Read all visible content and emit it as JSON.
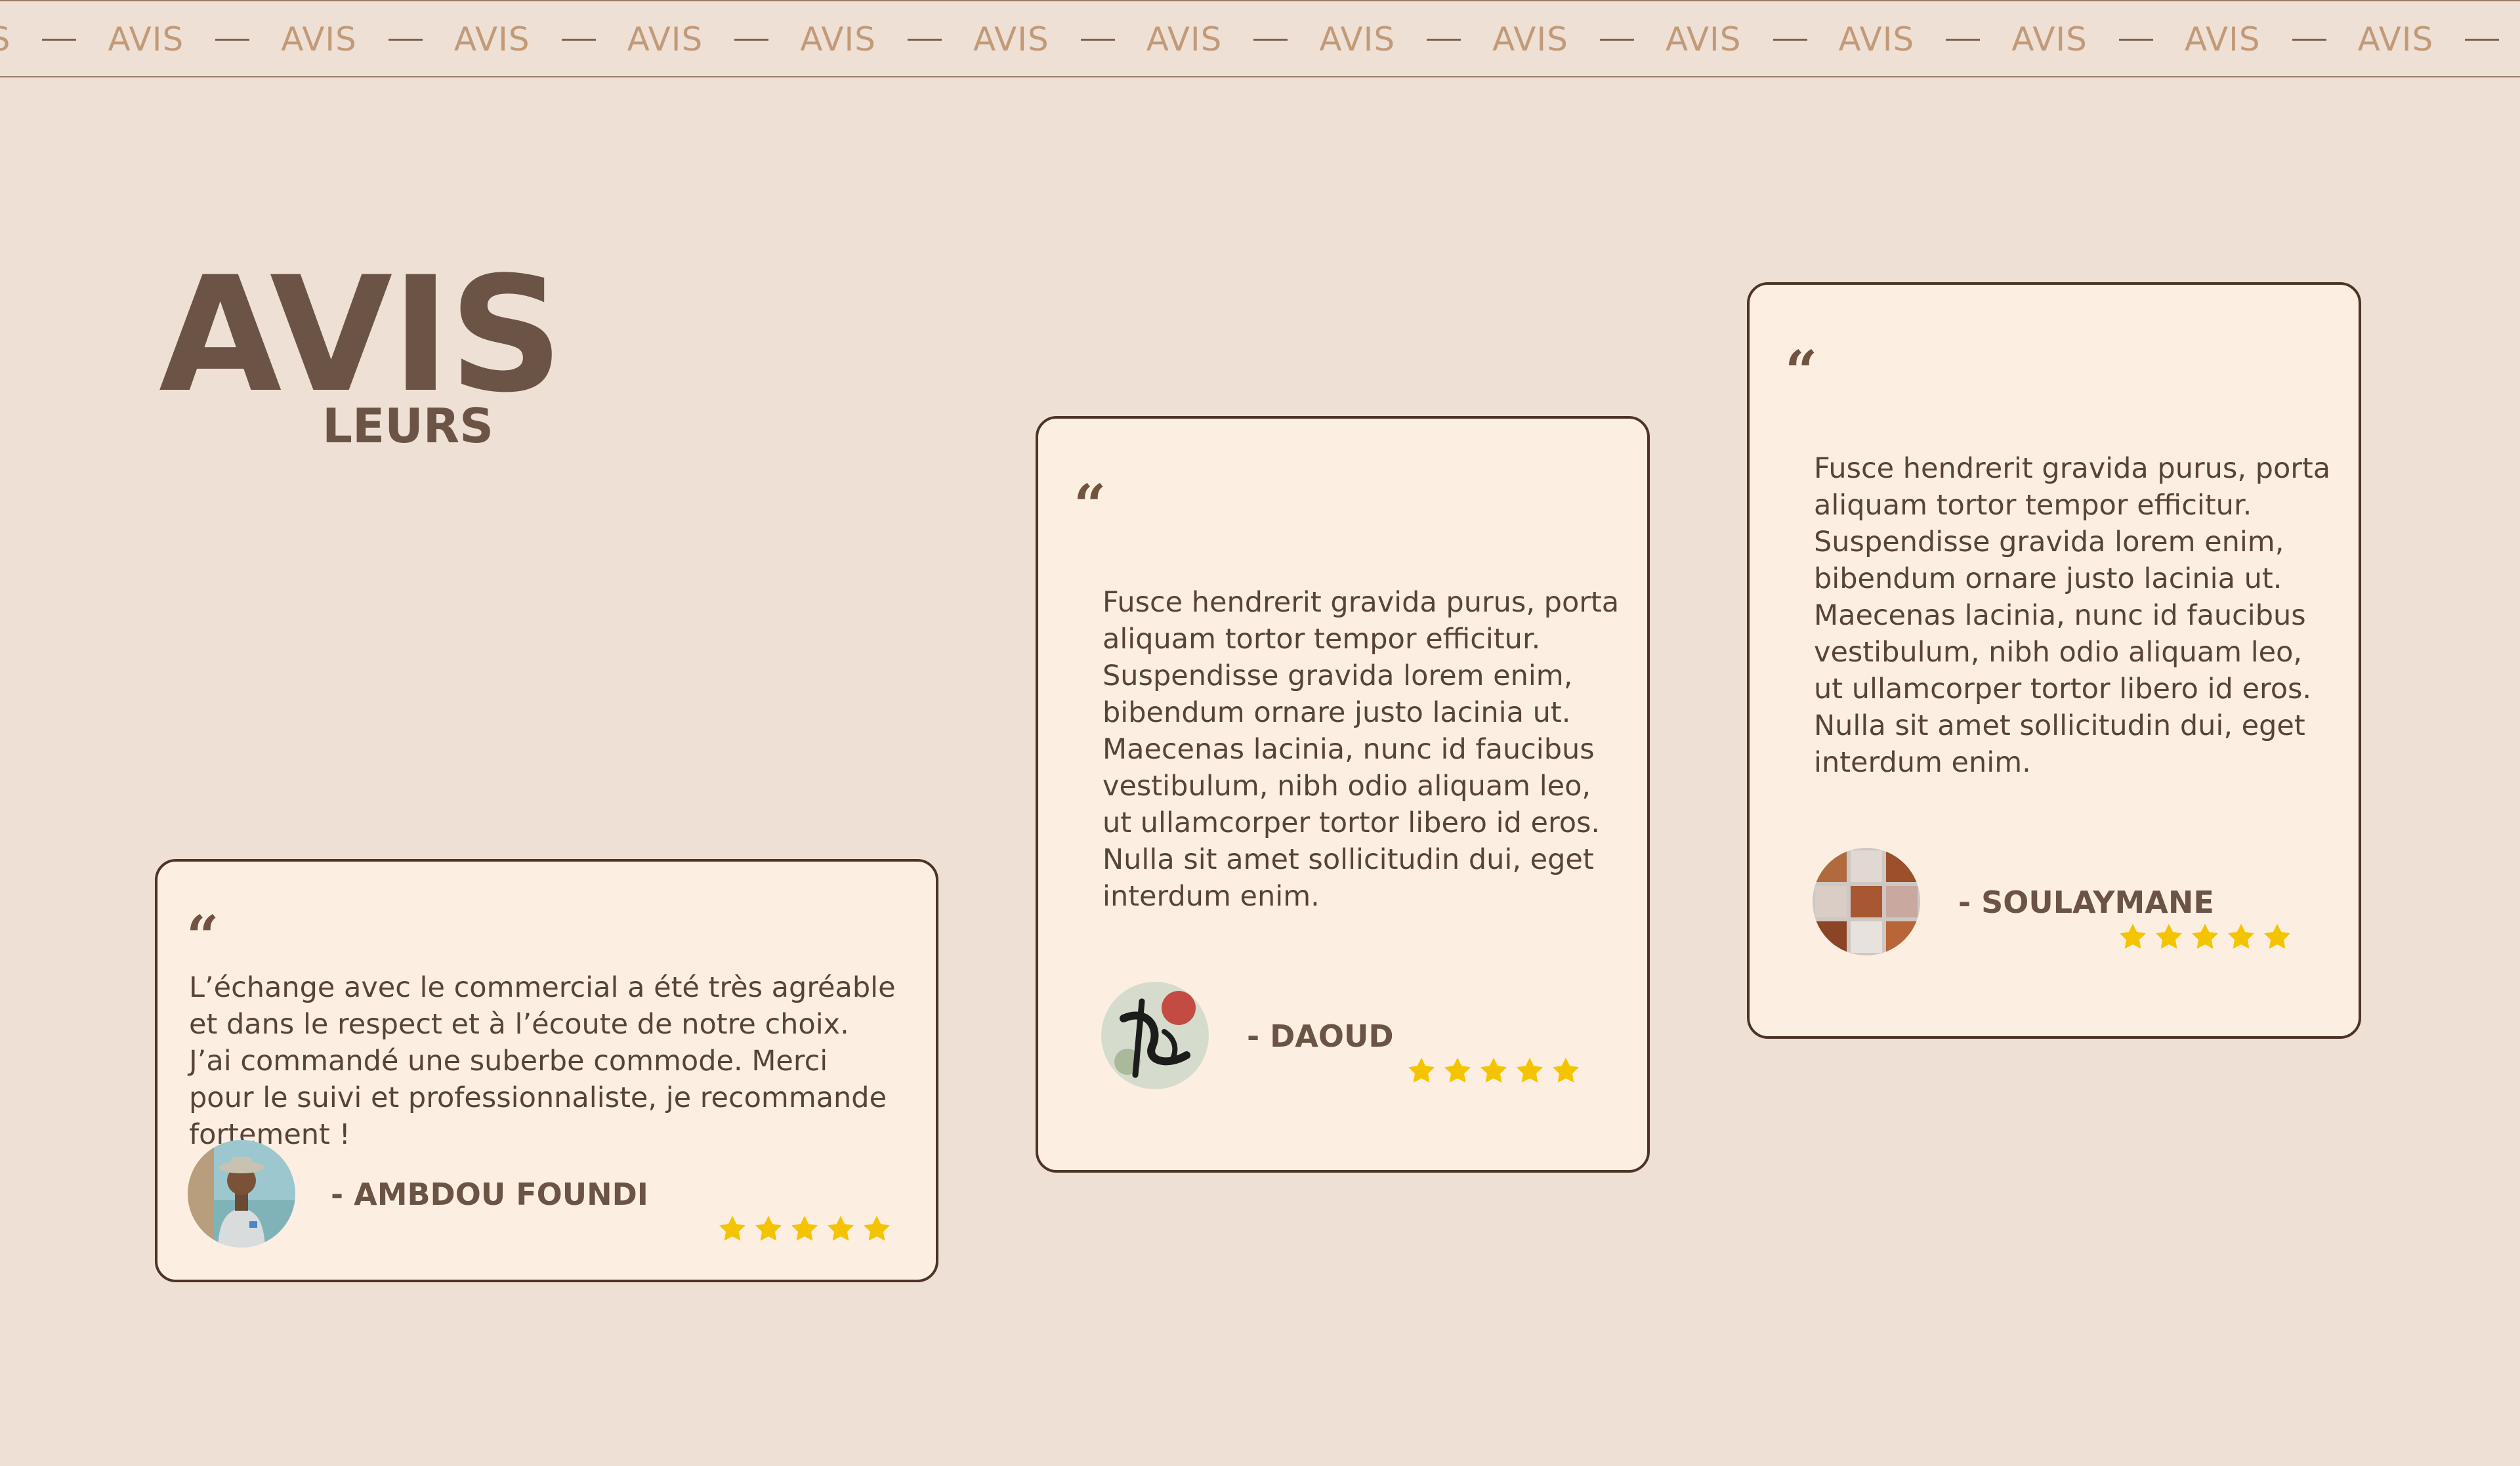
{
  "ticker": {
    "word": "AVIS",
    "first_partial": "IS"
  },
  "heading": {
    "main": "AVIS",
    "sub": "LEURS"
  },
  "reviews": [
    {
      "quote": "“",
      "text": "L’échange avec le commercial a été très agréable et dans le respect et à l’écoute de notre choix. J’ai commandé une suberbe commode. Merci pour le suivi et professionnaliste, je recommande fortement !",
      "author": "- AMBDOU FOUNDI",
      "rating": 5
    },
    {
      "quote": "“",
      "text": "Fusce hendrerit gravida purus, porta aliquam tortor tempor efficitur. Suspendisse gravida lorem enim, bibendum ornare justo lacinia ut. Maecenas lacinia, nunc id faucibus vestibulum, nibh odio aliquam leo, ut ullamcorper tortor libero id eros. Nulla sit amet sollicitudin dui, eget interdum enim.",
      "author": "- DAOUD",
      "rating": 5
    },
    {
      "quote": "“",
      "text": "Fusce hendrerit gravida purus, porta aliquam tortor tempor efficitur. Suspendisse gravida lorem enim, bibendum ornare justo lacinia ut. Maecenas lacinia, nunc id faucibus vestibulum, nibh odio aliquam leo, ut ullamcorper tortor libero id eros. Nulla sit amet sollicitudin dui, eget interdum enim.",
      "author": "- SOULAYMANE",
      "rating": 5
    }
  ],
  "colors": {
    "background": "#eee0d5",
    "card": "#fcefe2",
    "border": "#4d3426",
    "heading": "#6b5346",
    "ticker_text": "#c29a78",
    "star": "#f5c400"
  },
  "icons": {
    "quote": "quote-icon",
    "star": "star-icon"
  }
}
